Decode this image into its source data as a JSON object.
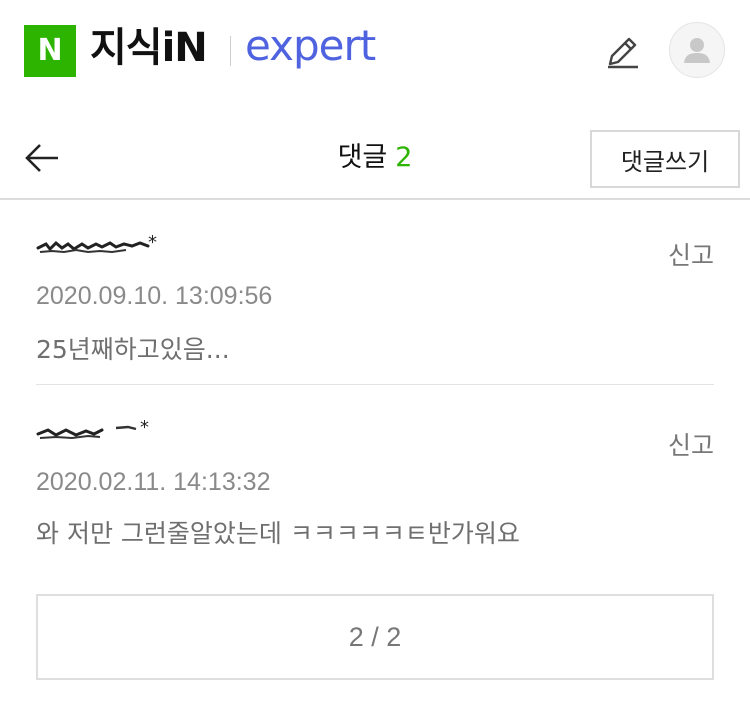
{
  "header": {
    "logo_letter": "N",
    "logo_text": "지식iN",
    "expert_text": "expert",
    "brand_green": "#2db400",
    "expert_color": "#4f63e0",
    "pencil_icon": "pencil-icon",
    "avatar_icon": "user-avatar-icon"
  },
  "subheader": {
    "title": "댓글",
    "count": "2",
    "write_button": "댓글쓰기",
    "back_icon": "arrow-left-icon"
  },
  "comments": [
    {
      "author": "",
      "report_label": "신고",
      "date": "2020.09.10. 13:09:56",
      "text": "25년째하고있음..."
    },
    {
      "author": "",
      "report_label": "신고",
      "date": "2020.02.11. 14:13:32",
      "text": "와 저만 그런줄알았는데 ㅋㅋㅋㅋㅋㅌ반가워요"
    }
  ],
  "pager": {
    "label": "2 / 2"
  }
}
